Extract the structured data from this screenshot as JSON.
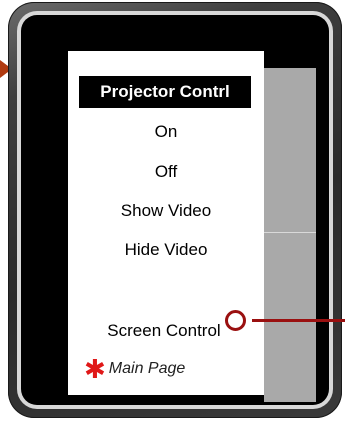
{
  "menu": {
    "title": "Projector Contrl",
    "items": [
      {
        "label": "On"
      },
      {
        "label": "Off"
      },
      {
        "label": "Show Video"
      },
      {
        "label": "Hide Video"
      },
      {
        "label": "Screen Control"
      }
    ],
    "main_page": {
      "label": "Main Page",
      "icon": "asterisk-icon",
      "icon_glyph": "✱",
      "icon_color": "#e01818"
    }
  },
  "colors": {
    "device_frame": "#2b2b2b",
    "screen_background": "#000000",
    "side_panel": "#a9a9a9",
    "callout": "#9a1010"
  }
}
